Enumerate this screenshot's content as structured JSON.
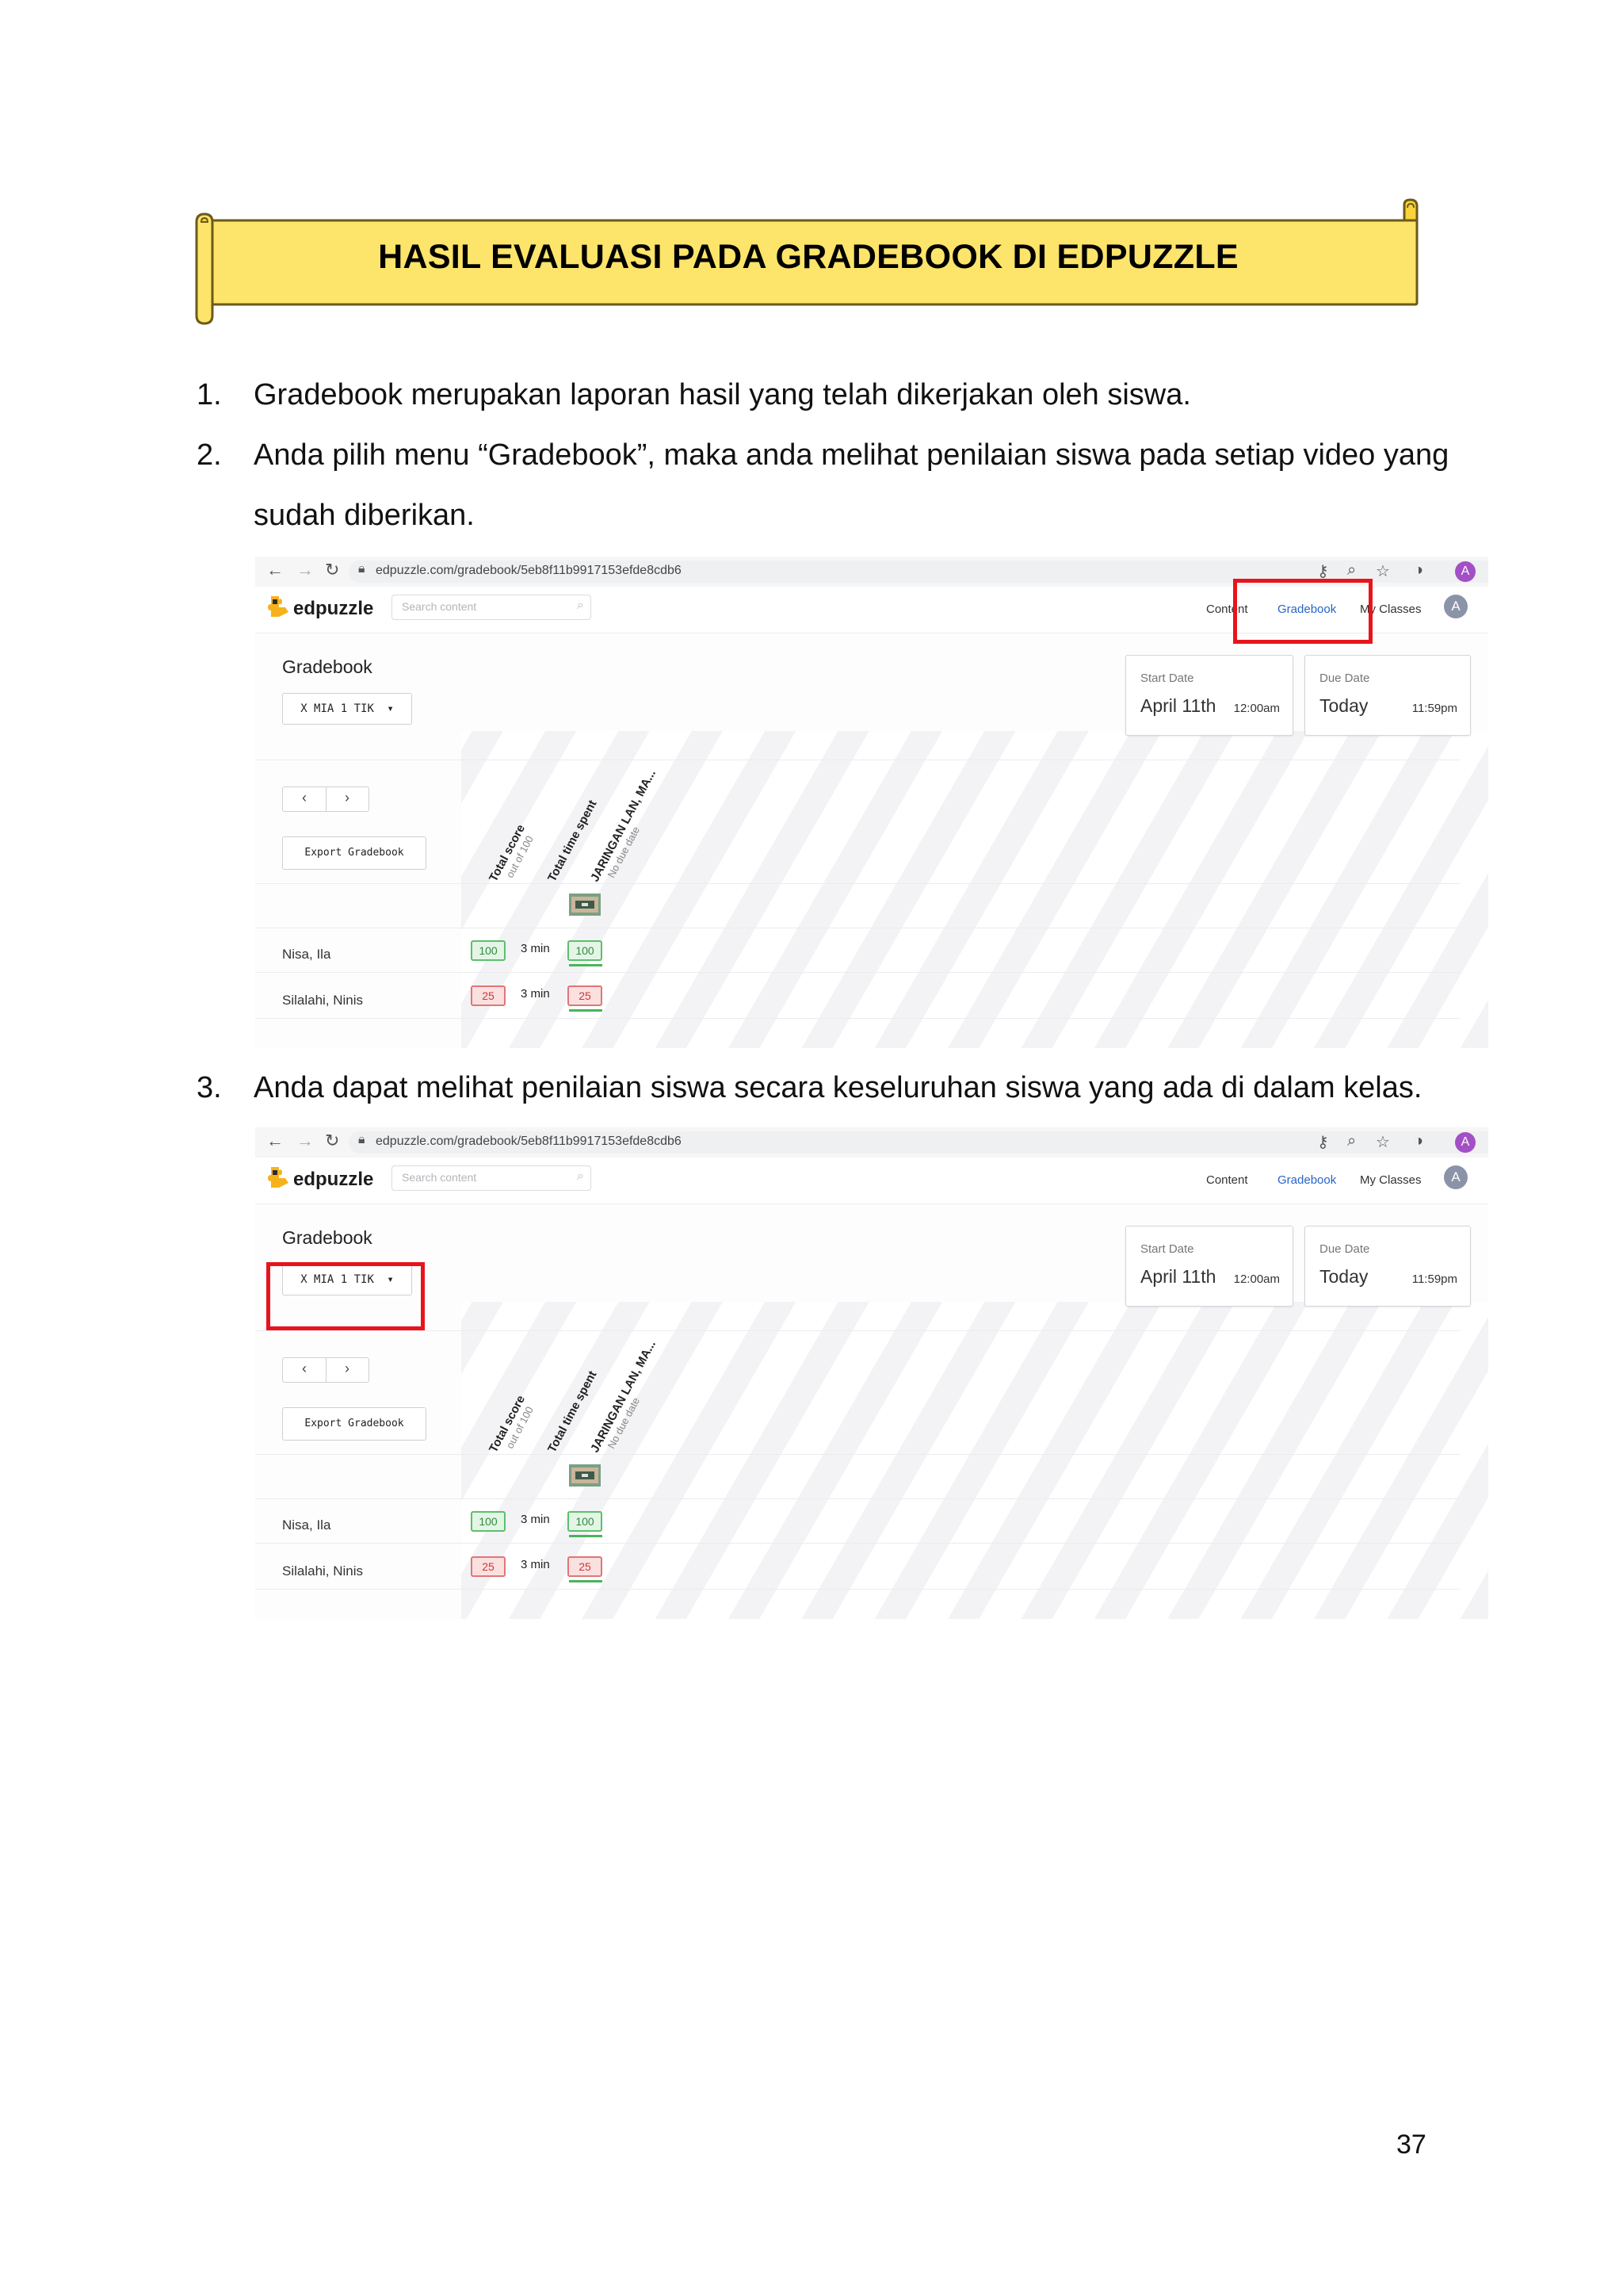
{
  "banner": {
    "title": "HASIL EVALUASI PADA GRADEBOOK DI EDPUZZLE"
  },
  "steps": [
    {
      "num": "1.",
      "text": "Gradebook merupakan laporan hasil yang telah dikerjakan oleh siswa."
    },
    {
      "num": "2.",
      "text": "Anda pilih menu “Gradebook”, maka anda melihat penilaian siswa pada setiap video yang sudah diberikan."
    },
    {
      "num": "3.",
      "text": "Anda dapat melihat penilaian siswa secara keseluruhan siswa yang ada di dalam kelas."
    }
  ],
  "screenshot": {
    "url": "edpuzzle.com/gradebook/5eb8f11b9917153efde8cdb6",
    "profile_initial": "A",
    "logo_text": "edpuzzle",
    "search_placeholder": "Search content",
    "nav": {
      "content": "Content",
      "gradebook": "Gradebook",
      "my_classes": "My Classes"
    },
    "avatar_initial": "A",
    "title": "Gradebook",
    "class_selected": "X MIA 1 TIK",
    "start_date": {
      "label": "Start Date",
      "value": "April 11th",
      "time": "12:00am"
    },
    "due_date": {
      "label": "Due Date",
      "value": "Today",
      "time": "11:59pm"
    },
    "pager": {
      "prev": "‹",
      "next": "›"
    },
    "export_label": "Export Gradebook",
    "columns": [
      {
        "title": "Total score",
        "subtitle": "out of 100"
      },
      {
        "title": "Total time spent",
        "subtitle": ""
      },
      {
        "title": "JARINGAN LAN, MA...",
        "subtitle": "No due date"
      }
    ],
    "students": [
      {
        "name": "Nisa, Ila",
        "total_score": "100",
        "time_spent": "3 min",
        "video_score": "100",
        "status": "good"
      },
      {
        "name": "Silalahi, Ninis",
        "total_score": "25",
        "time_spent": "3 min",
        "video_score": "25",
        "status": "bad"
      }
    ],
    "colors": {
      "highlight": "#e8141c",
      "good": "#5cbf6c",
      "bad": "#e07676",
      "link": "#2864c8"
    }
  },
  "page_number": "37"
}
